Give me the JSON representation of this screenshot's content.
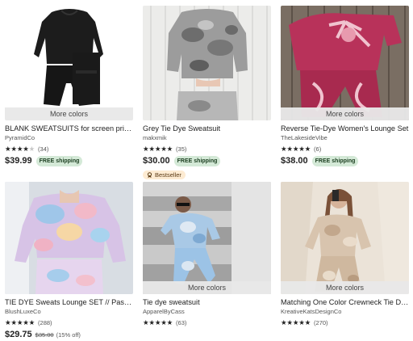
{
  "more_colors_label": "More colors",
  "colors": {
    "shipping_bg": "#d4e9d7",
    "bestseller_bg": "#fdebd2",
    "star": "#222222"
  },
  "products": [
    {
      "title": "BLANK SWEATSUITS for screen printing",
      "shop": "PyramidCo",
      "rating": 4,
      "reviews": "(34)",
      "price": "$39.99",
      "shipping": "FREE shipping",
      "more_colors": true
    },
    {
      "title": "Grey Tie Dye Sweatsuit",
      "shop": "makxmik",
      "rating": 5,
      "reviews": "(35)",
      "price": "$30.00",
      "shipping": "FREE shipping",
      "badge": "Bestseller"
    },
    {
      "title": "Reverse Tie-Dye Women's Lounge Set",
      "shop": "TheLakesideVibe",
      "rating": 5,
      "reviews": "(6)",
      "price": "$38.00",
      "shipping": "FREE shipping",
      "more_colors": true
    },
    {
      "title": "TIE DYE Sweats Lounge SET // Pastel Tie Dye",
      "shop": "BlushLuxeCo",
      "rating": 5,
      "reviews": "(288)",
      "price": "$29.75",
      "original_price": "$35.00",
      "discount": "(15% off)"
    },
    {
      "title": "Tie dye sweatsuit",
      "shop": "ApparelByCass",
      "rating": 5,
      "reviews": "(63)",
      "more_colors": true
    },
    {
      "title": "Matching One Color Crewneck Tie Dye Set",
      "shop": "KreativeKatsDesignCo",
      "rating": 5,
      "reviews": "(270)",
      "more_colors": true
    }
  ]
}
